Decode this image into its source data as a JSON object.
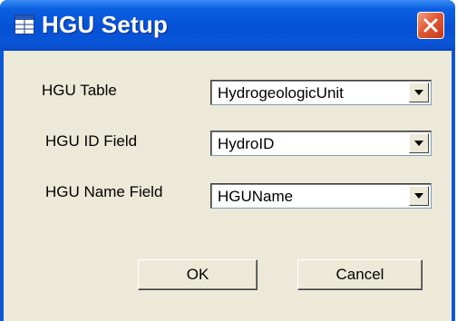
{
  "window": {
    "title": "HGU Setup",
    "icon": "table-app-icon",
    "close_icon": "close-icon"
  },
  "form": {
    "fields": [
      {
        "label": "HGU Table",
        "value": "HydrogeologicUnit"
      },
      {
        "label": "HGU ID Field",
        "value": "HydroID"
      },
      {
        "label": "HGU Name Field",
        "value": "HGUName"
      }
    ]
  },
  "buttons": {
    "ok_label": "OK",
    "cancel_label": "Cancel"
  },
  "colors": {
    "titlebar": "#0550d4",
    "dialog_face": "#ece9d8",
    "close_button": "#e25a32"
  }
}
